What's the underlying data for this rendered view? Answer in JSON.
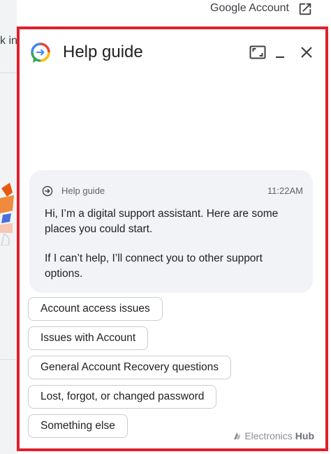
{
  "background": {
    "cut_text": "k in"
  },
  "topbar": {
    "google_account_label": "Google Account",
    "external_icon": "open-in-new-icon"
  },
  "panel": {
    "title": "Help guide",
    "logo_icon": "help-guide-logo",
    "controls": {
      "expand_icon": "open-in-full-icon",
      "minimize_icon": "minimize-icon",
      "close_icon": "close-icon"
    },
    "frame_color": "#e0202b"
  },
  "message": {
    "sender": "Help guide",
    "time": "11:22AM",
    "paragraph1": "Hi, I’m a digital support assistant. Here are some places you could start.",
    "paragraph2": "If I can’t help, I’ll connect you to other support options."
  },
  "options": [
    {
      "label": "Account access issues"
    },
    {
      "label": "Issues with Account"
    },
    {
      "label": "General Account Recovery questions"
    },
    {
      "label": "Lost, forgot, or changed password"
    },
    {
      "label": "Something else"
    }
  ],
  "watermark": {
    "text_light": "Electronics",
    "text_bold": "Hub"
  }
}
